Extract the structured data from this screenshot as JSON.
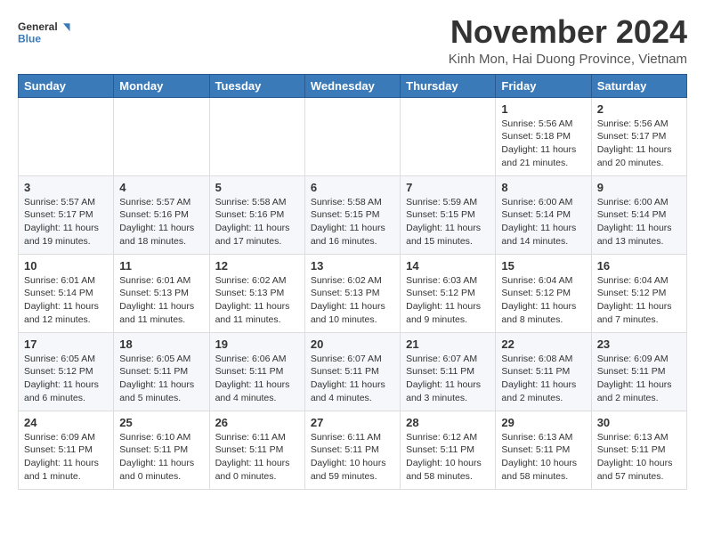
{
  "logo": {
    "line1": "General",
    "line2": "Blue"
  },
  "title": "November 2024",
  "subtitle": "Kinh Mon, Hai Duong Province, Vietnam",
  "days_header": [
    "Sunday",
    "Monday",
    "Tuesday",
    "Wednesday",
    "Thursday",
    "Friday",
    "Saturday"
  ],
  "weeks": [
    [
      {
        "day": "",
        "info": ""
      },
      {
        "day": "",
        "info": ""
      },
      {
        "day": "",
        "info": ""
      },
      {
        "day": "",
        "info": ""
      },
      {
        "day": "",
        "info": ""
      },
      {
        "day": "1",
        "info": "Sunrise: 5:56 AM\nSunset: 5:18 PM\nDaylight: 11 hours\nand 21 minutes."
      },
      {
        "day": "2",
        "info": "Sunrise: 5:56 AM\nSunset: 5:17 PM\nDaylight: 11 hours\nand 20 minutes."
      }
    ],
    [
      {
        "day": "3",
        "info": "Sunrise: 5:57 AM\nSunset: 5:17 PM\nDaylight: 11 hours\nand 19 minutes."
      },
      {
        "day": "4",
        "info": "Sunrise: 5:57 AM\nSunset: 5:16 PM\nDaylight: 11 hours\nand 18 minutes."
      },
      {
        "day": "5",
        "info": "Sunrise: 5:58 AM\nSunset: 5:16 PM\nDaylight: 11 hours\nand 17 minutes."
      },
      {
        "day": "6",
        "info": "Sunrise: 5:58 AM\nSunset: 5:15 PM\nDaylight: 11 hours\nand 16 minutes."
      },
      {
        "day": "7",
        "info": "Sunrise: 5:59 AM\nSunset: 5:15 PM\nDaylight: 11 hours\nand 15 minutes."
      },
      {
        "day": "8",
        "info": "Sunrise: 6:00 AM\nSunset: 5:14 PM\nDaylight: 11 hours\nand 14 minutes."
      },
      {
        "day": "9",
        "info": "Sunrise: 6:00 AM\nSunset: 5:14 PM\nDaylight: 11 hours\nand 13 minutes."
      }
    ],
    [
      {
        "day": "10",
        "info": "Sunrise: 6:01 AM\nSunset: 5:14 PM\nDaylight: 11 hours\nand 12 minutes."
      },
      {
        "day": "11",
        "info": "Sunrise: 6:01 AM\nSunset: 5:13 PM\nDaylight: 11 hours\nand 11 minutes."
      },
      {
        "day": "12",
        "info": "Sunrise: 6:02 AM\nSunset: 5:13 PM\nDaylight: 11 hours\nand 11 minutes."
      },
      {
        "day": "13",
        "info": "Sunrise: 6:02 AM\nSunset: 5:13 PM\nDaylight: 11 hours\nand 10 minutes."
      },
      {
        "day": "14",
        "info": "Sunrise: 6:03 AM\nSunset: 5:12 PM\nDaylight: 11 hours\nand 9 minutes."
      },
      {
        "day": "15",
        "info": "Sunrise: 6:04 AM\nSunset: 5:12 PM\nDaylight: 11 hours\nand 8 minutes."
      },
      {
        "day": "16",
        "info": "Sunrise: 6:04 AM\nSunset: 5:12 PM\nDaylight: 11 hours\nand 7 minutes."
      }
    ],
    [
      {
        "day": "17",
        "info": "Sunrise: 6:05 AM\nSunset: 5:12 PM\nDaylight: 11 hours\nand 6 minutes."
      },
      {
        "day": "18",
        "info": "Sunrise: 6:05 AM\nSunset: 5:11 PM\nDaylight: 11 hours\nand 5 minutes."
      },
      {
        "day": "19",
        "info": "Sunrise: 6:06 AM\nSunset: 5:11 PM\nDaylight: 11 hours\nand 4 minutes."
      },
      {
        "day": "20",
        "info": "Sunrise: 6:07 AM\nSunset: 5:11 PM\nDaylight: 11 hours\nand 4 minutes."
      },
      {
        "day": "21",
        "info": "Sunrise: 6:07 AM\nSunset: 5:11 PM\nDaylight: 11 hours\nand 3 minutes."
      },
      {
        "day": "22",
        "info": "Sunrise: 6:08 AM\nSunset: 5:11 PM\nDaylight: 11 hours\nand 2 minutes."
      },
      {
        "day": "23",
        "info": "Sunrise: 6:09 AM\nSunset: 5:11 PM\nDaylight: 11 hours\nand 2 minutes."
      }
    ],
    [
      {
        "day": "24",
        "info": "Sunrise: 6:09 AM\nSunset: 5:11 PM\nDaylight: 11 hours\nand 1 minute."
      },
      {
        "day": "25",
        "info": "Sunrise: 6:10 AM\nSunset: 5:11 PM\nDaylight: 11 hours\nand 0 minutes."
      },
      {
        "day": "26",
        "info": "Sunrise: 6:11 AM\nSunset: 5:11 PM\nDaylight: 11 hours\nand 0 minutes."
      },
      {
        "day": "27",
        "info": "Sunrise: 6:11 AM\nSunset: 5:11 PM\nDaylight: 10 hours\nand 59 minutes."
      },
      {
        "day": "28",
        "info": "Sunrise: 6:12 AM\nSunset: 5:11 PM\nDaylight: 10 hours\nand 58 minutes."
      },
      {
        "day": "29",
        "info": "Sunrise: 6:13 AM\nSunset: 5:11 PM\nDaylight: 10 hours\nand 58 minutes."
      },
      {
        "day": "30",
        "info": "Sunrise: 6:13 AM\nSunset: 5:11 PM\nDaylight: 10 hours\nand 57 minutes."
      }
    ]
  ]
}
